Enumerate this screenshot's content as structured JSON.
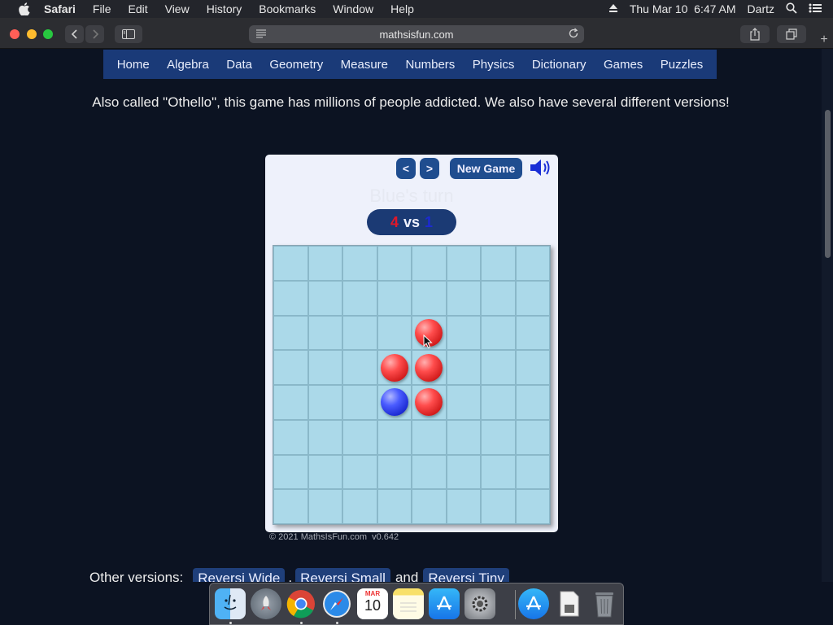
{
  "menubar": {
    "app": "Safari",
    "items": [
      "File",
      "Edit",
      "View",
      "History",
      "Bookmarks",
      "Window",
      "Help"
    ],
    "datetime": "Thu Mar 10  6:47 AM",
    "user": "Dartz",
    "icons": [
      "apple-logo-icon",
      "eject-icon",
      "spotlight-search-icon",
      "control-center-icon"
    ]
  },
  "browser": {
    "url": "mathsisfun.com",
    "icons": [
      "back-icon",
      "forward-icon",
      "sidebar-icon",
      "reader-icon",
      "reload-icon",
      "share-icon",
      "tabs-icon",
      "new-tab-icon"
    ]
  },
  "nav": {
    "items": [
      "Home",
      "Algebra",
      "Data",
      "Geometry",
      "Measure",
      "Numbers",
      "Physics",
      "Dictionary",
      "Games",
      "Puzzles"
    ]
  },
  "intro": "Also called \"Othello\", this game has millions of people addicted. We also have several different versions!",
  "game": {
    "prev_label": "<",
    "next_label": ">",
    "new_game_label": "New Game",
    "turn_text": "Blue's turn",
    "score": {
      "red": "4",
      "vs": "vs",
      "blue": "1"
    },
    "colors": {
      "red": "#e0182a",
      "blue": "#1c2ad2",
      "board": "#abd9e9"
    },
    "board": [
      [
        "",
        "",
        "",
        "",
        "",
        "",
        "",
        ""
      ],
      [
        "",
        "",
        "",
        "",
        "",
        "",
        "",
        ""
      ],
      [
        "",
        "",
        "",
        "",
        "red",
        "",
        "",
        ""
      ],
      [
        "",
        "",
        "",
        "red",
        "red",
        "",
        "",
        ""
      ],
      [
        "",
        "",
        "",
        "blue",
        "red",
        "",
        "",
        ""
      ],
      [
        "",
        "",
        "",
        "",
        "",
        "",
        "",
        ""
      ],
      [
        "",
        "",
        "",
        "",
        "",
        "",
        "",
        ""
      ],
      [
        "",
        "",
        "",
        "",
        "",
        "",
        "",
        ""
      ]
    ],
    "copyright": "© 2021 MathsIsFun.com  v0.642"
  },
  "other_versions": {
    "label": "Other versions:",
    "links": [
      "Reversi Wide",
      "Reversi Small",
      "Reversi Tiny"
    ],
    "comma": ",",
    "and": "and"
  },
  "dock": {
    "apps": [
      "Finder",
      "Launchpad",
      "Chrome",
      "Safari",
      "Calendar",
      "Notes",
      "App Store",
      "System Preferences",
      "App Store Downloads",
      "Documents",
      "Trash"
    ],
    "calendar_month": "MAR",
    "calendar_day": "10"
  }
}
